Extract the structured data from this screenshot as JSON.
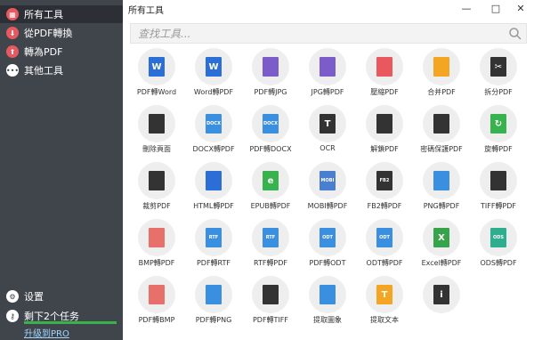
{
  "sidebar": {
    "items": [
      {
        "label": "所有工具",
        "icon": "grid-icon",
        "color": "#e8585e",
        "active": true
      },
      {
        "label": "從PDF轉換",
        "icon": "download-icon",
        "color": "#e8585e",
        "active": false
      },
      {
        "label": "轉為PDF",
        "icon": "upload-icon",
        "color": "#e8585e",
        "active": false
      },
      {
        "label": "其他工具",
        "icon": "more-icon",
        "color": "#ffffff",
        "active": false
      }
    ],
    "settings_label": "设置",
    "tasks_label": "剩下2个任务",
    "progress": 1.0,
    "upgrade_label": "升级到PRO"
  },
  "window": {
    "title": "所有工具",
    "minimize": "—",
    "maximize": "□",
    "close": "✕"
  },
  "search": {
    "placeholder": "查找工具..."
  },
  "tools": [
    {
      "label": "PDF轉Word",
      "icon": "pdf-to-word-icon",
      "color": "#2b6fd6",
      "text": "W"
    },
    {
      "label": "Word轉PDF",
      "icon": "word-to-pdf-icon",
      "color": "#2b6fd6",
      "text": "W"
    },
    {
      "label": "PDF轉JPG",
      "icon": "pdf-to-jpg-icon",
      "color": "#7b5cc8",
      "text": ""
    },
    {
      "label": "JPG轉PDF",
      "icon": "jpg-to-pdf-icon",
      "color": "#7b5cc8",
      "text": ""
    },
    {
      "label": "壓縮PDF",
      "icon": "compress-icon",
      "color": "#e8585e",
      "text": ""
    },
    {
      "label": "合并PDF",
      "icon": "merge-icon",
      "color": "#f4a623",
      "text": ""
    },
    {
      "label": "拆分PDF",
      "icon": "scissors-icon",
      "color": "#333333",
      "text": "✂"
    },
    {
      "label": "刪除頁面",
      "icon": "trash-icon",
      "color": "#333333",
      "text": ""
    },
    {
      "label": "DOCX轉PDF",
      "icon": "docx-to-pdf-icon",
      "color": "#3a8fe0",
      "text": "DOCX"
    },
    {
      "label": "PDF轉DOCX",
      "icon": "pdf-to-docx-icon",
      "color": "#3a8fe0",
      "text": "DOCX"
    },
    {
      "label": "OCR",
      "icon": "ocr-icon",
      "color": "#333333",
      "text": "T"
    },
    {
      "label": "解鎖PDF",
      "icon": "unlock-icon",
      "color": "#333333",
      "text": ""
    },
    {
      "label": "密碼保護PDF",
      "icon": "lock-icon",
      "color": "#333333",
      "text": ""
    },
    {
      "label": "旋轉PDF",
      "icon": "rotate-icon",
      "color": "#37b24d",
      "text": "↻"
    },
    {
      "label": "裁剪PDF",
      "icon": "crop-icon",
      "color": "#333333",
      "text": ""
    },
    {
      "label": "HTML轉PDF",
      "icon": "globe-icon",
      "color": "#2b6fd6",
      "text": ""
    },
    {
      "label": "EPUB轉PDF",
      "icon": "epub-icon",
      "color": "#37b24d",
      "text": "e"
    },
    {
      "label": "MOBI轉PDF",
      "icon": "mobi-icon",
      "color": "#4a7fd0",
      "text": "MOBI"
    },
    {
      "label": "FB2轉PDF",
      "icon": "fb2-icon",
      "color": "#333333",
      "text": "FB2"
    },
    {
      "label": "PNG轉PDF",
      "icon": "png-icon",
      "color": "#3a8fe0",
      "text": ""
    },
    {
      "label": "TIFF轉PDF",
      "icon": "camera-icon",
      "color": "#333333",
      "text": ""
    },
    {
      "label": "BMP轉PDF",
      "icon": "brush-icon",
      "color": "#e8706a",
      "text": ""
    },
    {
      "label": "PDF轉RTF",
      "icon": "pdf-to-rtf-icon",
      "color": "#3a8fe0",
      "text": "RTF"
    },
    {
      "label": "RTF轉PDF",
      "icon": "rtf-to-pdf-icon",
      "color": "#3a8fe0",
      "text": "RTF"
    },
    {
      "label": "PDF轉ODT",
      "icon": "pdf-to-odt-icon",
      "color": "#3a8fe0",
      "text": "ODT"
    },
    {
      "label": "ODT轉PDF",
      "icon": "odt-to-pdf-icon",
      "color": "#3a8fe0",
      "text": "ODT"
    },
    {
      "label": "Excel轉PDF",
      "icon": "excel-icon",
      "color": "#37a34a",
      "text": "X"
    },
    {
      "label": "ODS轉PDF",
      "icon": "ods-icon",
      "color": "#2fae8f",
      "text": "ODS"
    },
    {
      "label": "PDF轉BMP",
      "icon": "pdf-to-bmp-icon",
      "color": "#e8706a",
      "text": ""
    },
    {
      "label": "PDF轉PNG",
      "icon": "pdf-to-png-icon",
      "color": "#3a8fe0",
      "text": ""
    },
    {
      "label": "PDF轉TIFF",
      "icon": "pdf-to-tiff-icon",
      "color": "#333333",
      "text": ""
    },
    {
      "label": "提取圖象",
      "icon": "extract-images-icon",
      "color": "#3a8fe0",
      "text": ""
    },
    {
      "label": "提取文本",
      "icon": "extract-text-icon",
      "color": "#f4a623",
      "text": "T"
    },
    {
      "label": "",
      "icon": "info-icon",
      "color": "#333333",
      "text": "i"
    }
  ]
}
